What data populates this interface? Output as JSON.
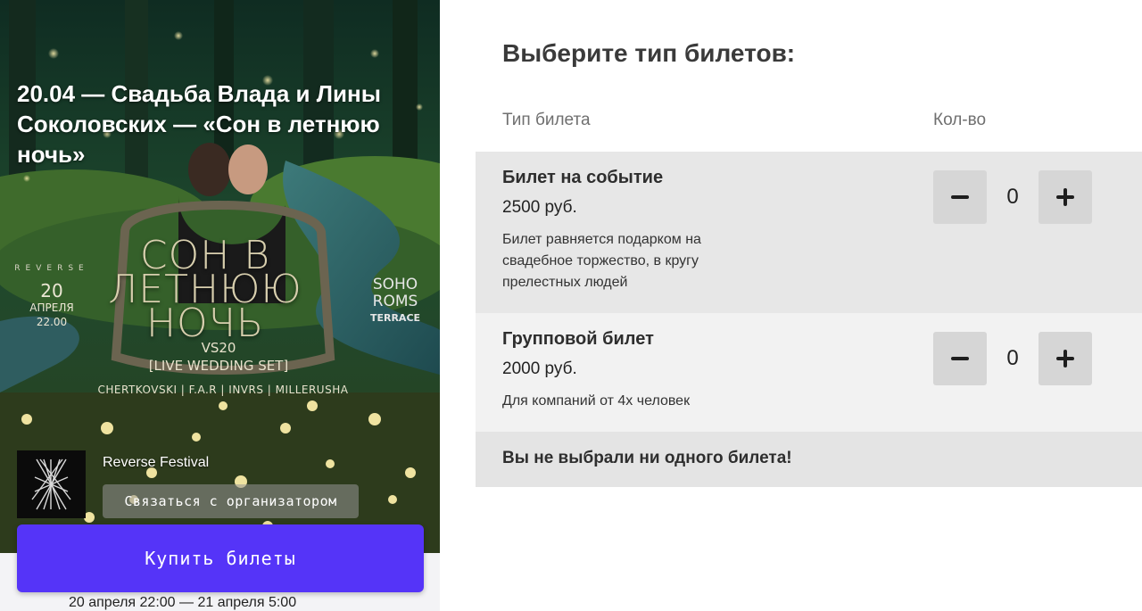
{
  "event": {
    "title": "20.04 — Свадьба Влада и Лины Соколовских — «Сон в летнюю ночь»",
    "dates": "20 апреля 22:00 — 21 апреля 5:00"
  },
  "poster": {
    "headline": "СОН В ЛЕТНЮЮ НОЧЬ",
    "set": "VS20",
    "subtitle": "[LIVE WEDDING SET]",
    "lineup": "CHERTKOVSKI | F.A.R | INVRS | MILLERUSHA",
    "brand": "REVERSE",
    "day": "20",
    "month": "АПРЕЛЯ",
    "time": "22.00",
    "venue": "SOHO ROMS",
    "venue_sub": "TERRACE"
  },
  "organizer": {
    "name": "Reverse Festival",
    "contact_label": "Связаться с организатором"
  },
  "buy_button": {
    "label": "Купить билеты"
  },
  "tickets": {
    "title": "Выберите тип билетов:",
    "columns": {
      "type": "Тип билета",
      "qty": "Кол-во"
    },
    "items": [
      {
        "name": "Билет на событие",
        "price": "2500 руб.",
        "description": "Билет равняется подарком на свадебное торжество, в кругу прелестных людей",
        "qty": "0"
      },
      {
        "name": "Групповой билет",
        "price": "2000 руб.",
        "description": "Для компаний от 4х человек",
        "qty": "0"
      }
    ],
    "status": "Вы не выбрали ни одного билета!"
  },
  "colors": {
    "buy_button": "#5534f8",
    "row_primary": "#e7e7e7",
    "row_secondary": "#f2f2f2",
    "qty_button": "#d6d6d6"
  },
  "icons": {
    "minus": "minus-icon",
    "plus": "plus-icon",
    "organizer_logo": "reverse-logo"
  }
}
